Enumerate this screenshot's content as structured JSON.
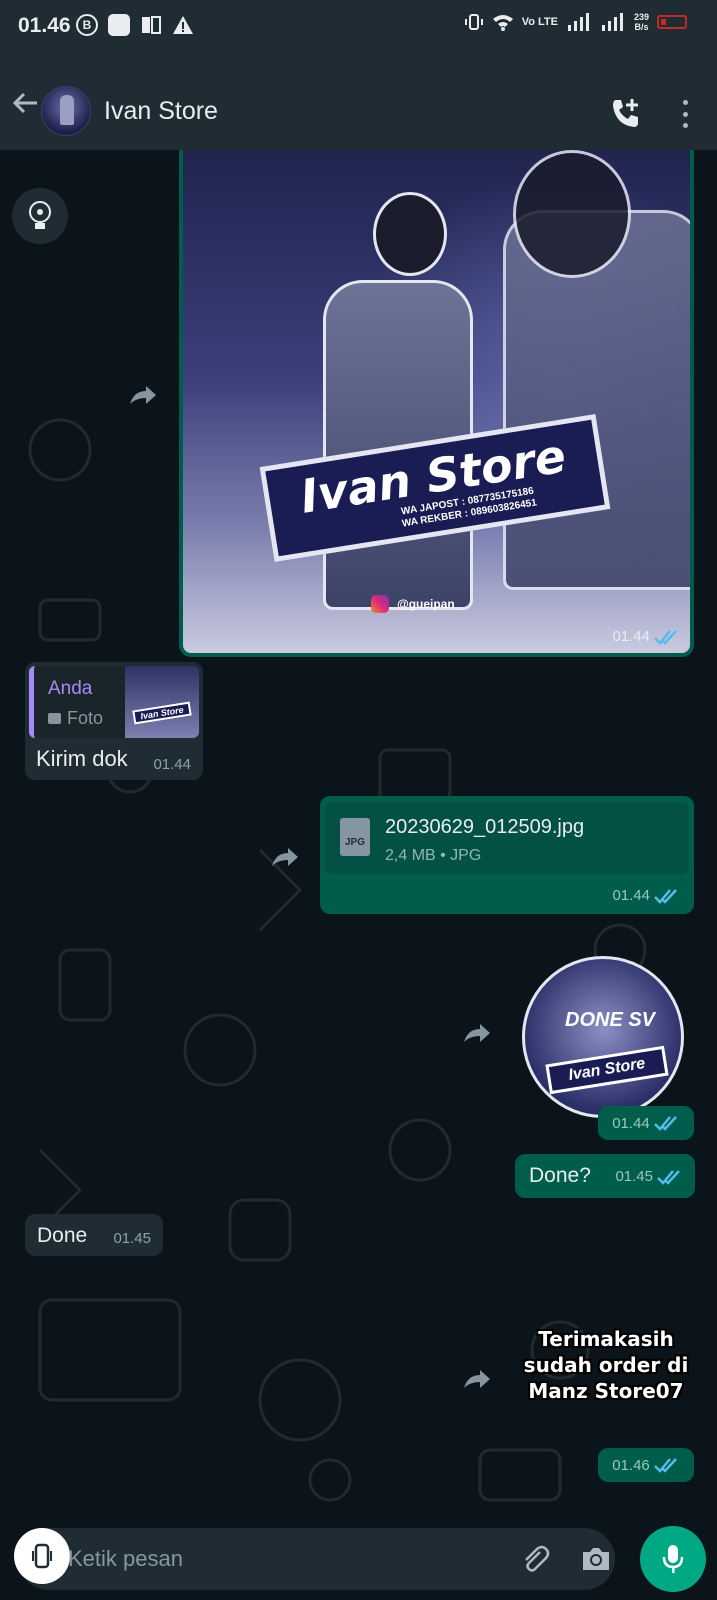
{
  "status_bar": {
    "time": "01.46",
    "left_icons": [
      "b-icon",
      "app-icon",
      "nfc-icon",
      "warning-icon"
    ],
    "b_label": "B",
    "network": "Vo LTE",
    "speed_value": "239",
    "speed_unit": "B/s"
  },
  "header": {
    "title": "Ivan Store",
    "back_icon": "arrow-left-icon",
    "call_icon": "add-call-icon",
    "menu_icon": "more-vert-icon"
  },
  "messages": {
    "image_message": {
      "banner_title": "Ivan Store",
      "banner_line1": "WA JAPOST   : 087735175186",
      "banner_line2": "WA REKBER  : 089603826451",
      "instagram": "@gueipan_",
      "time": "01.44"
    },
    "reply_message": {
      "quote_author": "Anda",
      "quote_type": "Foto",
      "quote_thumb_text": "Ivan Store",
      "text": "Kirim dok",
      "time": "01.44"
    },
    "document_message": {
      "icon_label": "JPG",
      "file_name": "20230629_012509.jpg",
      "file_meta": "2,4 MB • JPG",
      "time": "01.44"
    },
    "sticker_1": {
      "text_top": "DONE SV",
      "banner": "Ivan Store",
      "time": "01.44"
    },
    "outgoing_done": {
      "text": "Done?",
      "time": "01.45"
    },
    "incoming_done": {
      "text": "Done",
      "time": "01.45"
    },
    "sticker_2": {
      "line1": "Terimakasih",
      "line2": "sudah order di",
      "line3": "Manz Store07",
      "time": "01.46"
    }
  },
  "compose": {
    "placeholder": "Ketik pesan",
    "attach_icon": "paperclip-icon",
    "camera_icon": "camera-icon",
    "mic_icon": "mic-icon"
  },
  "colors": {
    "header_bg": "#1f2c34",
    "chat_bg": "#0b141a",
    "outgoing_bubble": "#005c4b",
    "incoming_bubble": "#1f2c34",
    "accent": "#00a884",
    "read_ticks": "#53bdeb",
    "quote_author": "#a58af5"
  }
}
